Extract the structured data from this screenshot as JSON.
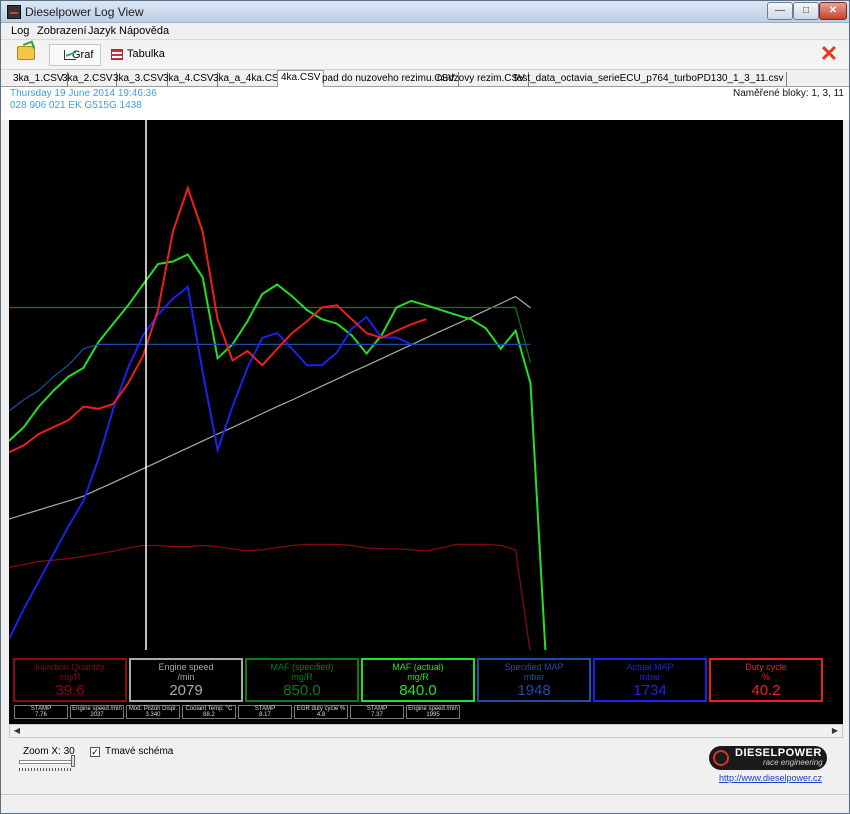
{
  "window": {
    "title": "Dieselpower Log View"
  },
  "menu": [
    "Log",
    "Zobrazení",
    "Jazyk",
    "Nápověda"
  ],
  "toolbar": {
    "graf_label": "Graf",
    "tabulka_label": "Tabulka"
  },
  "tabs": [
    "3ka_1.CSV",
    "3ka_2.CSV",
    "3ka_3.CSV",
    "3ka_4.CSV",
    "3ka_a_4ka.CSV",
    "4ka.CSV",
    "pad do nuzoveho rezimu.CSV",
    "nudzovy rezim.CSV",
    "test_data_octavia_serieECU_p764_turboPD130_1_3_11.csv"
  ],
  "active_tab": "4ka.CSV",
  "info": {
    "date": "Thursday 19 June 2014 19:46:36",
    "ecu": "028 906 021 EK  G515G  1438",
    "blocks": "Naměřené bloky: 1, 3, 11"
  },
  "colors": {
    "injection": "#8b0a0a",
    "engine_speed": "#aaaaaa",
    "maf_spec": "#0e7a12",
    "maf_act": "#22e022",
    "map_spec": "#1a4fa5",
    "map_act": "#1a22ee",
    "duty": "#ee1e1e"
  },
  "chart_data": {
    "type": "line",
    "cursor_index": 6,
    "series": [
      {
        "name": "Injection Quantity",
        "color": "#8b0a0a",
        "values": [
          17.6,
          18.4,
          19.2,
          19.6,
          20,
          20.6,
          21.3,
          22,
          22.9,
          23.6,
          23.6,
          23.3,
          23.3,
          23.6,
          23.3,
          22.7,
          22.1,
          22.4,
          23,
          23.6,
          23.9,
          23.9,
          23.9,
          23.6,
          22.9,
          22.7,
          22.7,
          22.4,
          22.1,
          22.9,
          23.9,
          23.9,
          23.9,
          23.6,
          22.4,
          -6
        ]
      },
      {
        "name": "Engine speed",
        "color": "#aaaaaa",
        "values": [
          30.8,
          32.1,
          33.3,
          34.6,
          35.8,
          37.1,
          39,
          40.8,
          42.7,
          44.6,
          46.5,
          48.4,
          50.3,
          52.2,
          54.1,
          55.9,
          57.8,
          59.7,
          61.6,
          63.4,
          65.3,
          67.2,
          69.1,
          71,
          72.8,
          74.7,
          76.6,
          78.5,
          80.4,
          82.3,
          84.1,
          86,
          87.9,
          89.8,
          91.7,
          88.6
        ]
      },
      {
        "name": "MAF (specified)",
        "color": "#0e7a12",
        "values": [
          88.7,
          88.7,
          88.7,
          88.7,
          88.7,
          88.7,
          88.7,
          88.7,
          88.7,
          88.7,
          88.7,
          88.7,
          88.7,
          88.7,
          88.7,
          88.7,
          88.7,
          88.7,
          88.7,
          88.7,
          88.7,
          88.7,
          88.7,
          88.7,
          88.7,
          88.7,
          88.7,
          88.7,
          88.7,
          88.7,
          88.7,
          88.7,
          88.7,
          88.7,
          88.7,
          73.6
        ]
      },
      {
        "name": "MAF (actual)",
        "color": "#22e022",
        "values": [
          52.2,
          56,
          61.6,
          66,
          69.8,
          72.2,
          79.2,
          84.3,
          89.3,
          95,
          100.6,
          101.3,
          103.2,
          96.9,
          74.8,
          78.6,
          84.9,
          92.4,
          95,
          91.8,
          88,
          85.5,
          84.3,
          81.1,
          76.1,
          81.1,
          88.7,
          90.5,
          89.3,
          88,
          86.7,
          85.5,
          83,
          77.4,
          82.3,
          68,
          -5.2
        ]
      },
      {
        "name": "Specified MAP",
        "color": "#1a4fa5",
        "values": [
          60.4,
          63.5,
          66,
          69.8,
          73,
          77.4,
          78.6,
          78.6,
          78.6,
          78.6,
          78.6,
          78.6,
          78.6,
          78.6,
          78.6,
          78.6,
          78.6,
          78.6,
          78.6,
          78.6,
          78.6,
          78.6,
          78.6,
          78.6,
          78.6,
          78.6,
          78.6,
          78.6,
          78.6,
          78.6,
          78.6,
          78.6,
          78.6,
          78.6,
          78.6,
          78.6
        ]
      },
      {
        "name": "Actual MAP",
        "color": "#1a22ee",
        "values": [
          -2,
          6.3,
          13.8,
          21.4,
          28.9,
          35.8,
          47.2,
          61,
          72.3,
          81.1,
          86.7,
          91.1,
          94.3,
          71,
          49.7,
          61.6,
          72.2,
          80.4,
          81.7,
          77.4,
          72.9,
          72.9,
          76.4,
          82.9,
          86.1,
          80.5,
          80.5,
          78.6
        ]
      },
      {
        "name": "Duty cycle",
        "color": "#ee1e1e",
        "values": [
          49.1,
          51,
          54.1,
          56,
          57.9,
          61.6,
          61,
          62.3,
          68,
          75.5,
          88,
          109.4,
          121.4,
          109.4,
          85.5,
          74.2,
          76.8,
          72.9,
          77.4,
          81.7,
          84.9,
          88.7,
          89.3,
          85.5,
          81.7,
          80.4,
          82.3,
          84.1,
          85.5
        ]
      }
    ],
    "ylim": [
      -5,
      140
    ]
  },
  "panels": [
    {
      "name": "Injection Quantity",
      "unit": "mg/R",
      "value": "39.6",
      "color": "#8b0a0a"
    },
    {
      "name": "Engine speed",
      "unit": "/min",
      "value": "2079",
      "color": "#aaaaaa"
    },
    {
      "name": "MAF (specified)",
      "unit": "mg/R",
      "value": "850.0",
      "color": "#0e7a12"
    },
    {
      "name": "MAF (actual)",
      "unit": "mg/R",
      "value": "840.0",
      "color": "#22e022"
    },
    {
      "name": "Specified MAP",
      "unit": "mbar",
      "value": "1948",
      "color": "#1a4fa5"
    },
    {
      "name": "Actual MAP",
      "unit": "mbar",
      "value": "1734",
      "color": "#1a22ee"
    },
    {
      "name": "Duty cycle",
      "unit": "%",
      "value": "40.2",
      "color": "#ee1e1e"
    }
  ],
  "minis": [
    {
      "name": "STAMP",
      "value": "7.76"
    },
    {
      "name": "Engine speed /min",
      "value": "2037"
    },
    {
      "name": "Mod. Piston Displ.",
      "value": "3.340"
    },
    {
      "name": "Coolant Temp. °C",
      "value": "88.2"
    },
    {
      "name": "STAMP",
      "value": "8.17"
    },
    {
      "name": "EGR duty cycle %",
      "value": "4.8"
    },
    {
      "name": "STAMP",
      "value": "7.37"
    },
    {
      "name": "Engine speed /min",
      "value": "1995"
    }
  ],
  "bottom": {
    "zoom_label": "Zoom X: 30",
    "dark_scheme_label": "Tmavé schéma",
    "dark_scheme_checked": "✓",
    "logo_text": "DIESELPOWER",
    "logo_sub": "race engineering",
    "link": "http://www.dieselpower.cz"
  }
}
